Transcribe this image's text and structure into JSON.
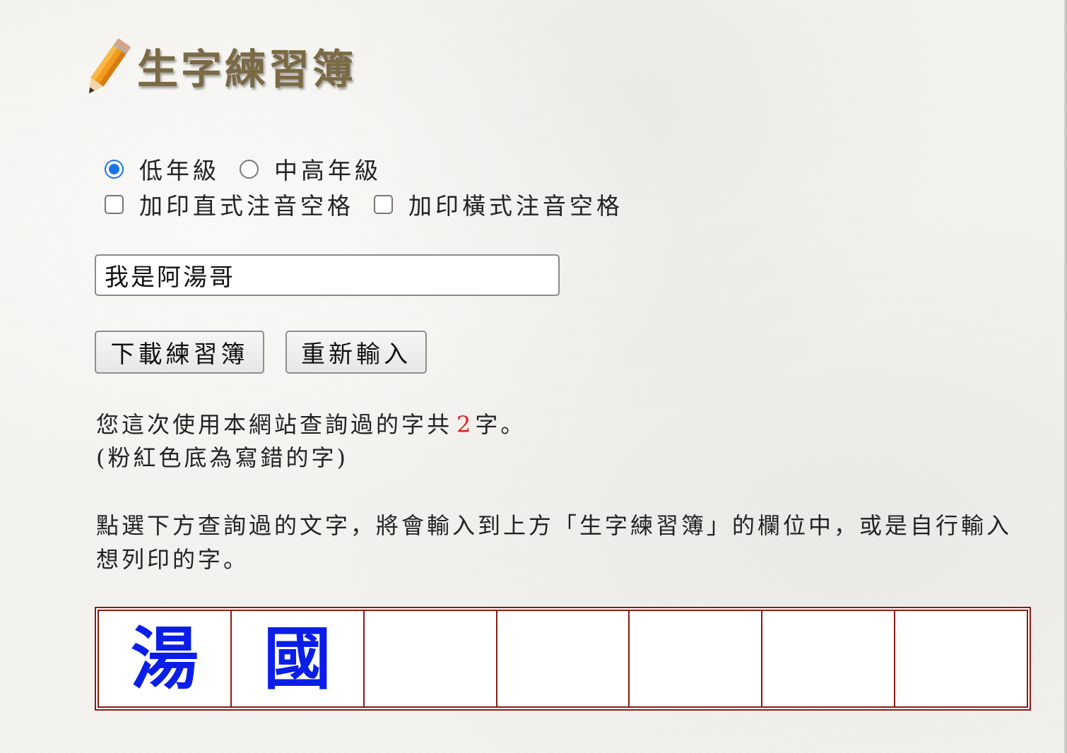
{
  "header": {
    "title": "生字練習簿",
    "logo_icon": "pencil-icon"
  },
  "options": {
    "grade_low": {
      "label": "低年級",
      "checked": true
    },
    "grade_mid_high": {
      "label": "中高年級",
      "checked": false
    },
    "vertical_zhuyin": {
      "label": "加印直式注音空格",
      "checked": false
    },
    "horizontal_zhuyin": {
      "label": "加印橫式注音空格",
      "checked": false
    }
  },
  "input": {
    "value": "我是阿湯哥"
  },
  "buttons": {
    "download_label": "下載練習簿",
    "reset_label": "重新輸入"
  },
  "info": {
    "prefix": "您這次使用本網站查詢過的字共",
    "count": "2",
    "suffix": "字。",
    "note": "(粉紅色底為寫錯的字)"
  },
  "instruction": "點選下方查詢過的文字，將會輸入到上方「生字練習簿」的欄位中，或是自行輸入想列印的字。",
  "queried_chars": [
    "湯",
    "國",
    "",
    "",
    "",
    "",
    ""
  ],
  "colors": {
    "count": "#e0201a",
    "char": "#0a1ee8",
    "grid_border": "#8b1a14",
    "title": "#7a6a45"
  }
}
